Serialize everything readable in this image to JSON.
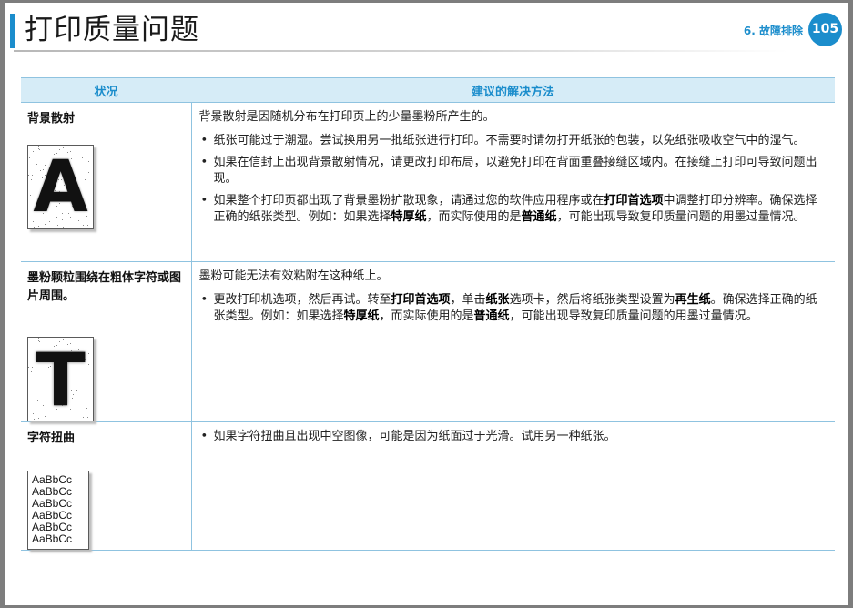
{
  "header": {
    "title": "打印质量问题",
    "chapter": "6. 故障排除",
    "page_number": "105"
  },
  "table": {
    "headers": [
      "状况",
      "建议的解决方法"
    ],
    "rows": [
      {
        "condition": "背景散射",
        "sample_text": "A",
        "intro": "背景散射是因随机分布在打印页上的少量墨粉所产生的。",
        "bullets": [
          [
            {
              "t": "纸张可能过于潮湿。尝试换用另一批纸张进行打印。不需要时请勿打开纸张的包装，以免纸张吸收空气中的湿气。"
            }
          ],
          [
            {
              "t": "如果在信封上出现背景散射情况，请更改打印布局，以避免打印在背面重叠接缝区域内。在接缝上打印可导致问题出现。"
            }
          ],
          [
            {
              "t": "如果整个打印页都出现了背景墨粉扩散现象，请通过您的软件应用程序或在"
            },
            {
              "t": "打印首选项",
              "b": true
            },
            {
              "t": "中调整打印分辨率。确保选择正确的纸张类型。例如：如果选择"
            },
            {
              "t": "特厚纸",
              "b": true
            },
            {
              "t": "，而实际使用的是"
            },
            {
              "t": "普通纸",
              "b": true
            },
            {
              "t": "，可能出现导致复印质量问题的用墨过量情况。"
            }
          ]
        ]
      },
      {
        "condition": "墨粉颗粒围绕在粗体字符或图片周围。",
        "sample_text": "T",
        "intro": "墨粉可能无法有效粘附在这种纸上。",
        "bullets": [
          [
            {
              "t": "更改打印机选项，然后再试。转至"
            },
            {
              "t": "打印首选项",
              "b": true
            },
            {
              "t": "，单击"
            },
            {
              "t": "纸张",
              "b": true
            },
            {
              "t": "选项卡，然后将纸张类型设置为"
            },
            {
              "t": "再生纸",
              "b": true
            },
            {
              "t": "。确保选择正确的纸张类型。例如：如果选择"
            },
            {
              "t": "特厚纸",
              "b": true
            },
            {
              "t": "，而实际使用的是"
            },
            {
              "t": "普通纸",
              "b": true
            },
            {
              "t": "，可能出现导致复印质量问题的用墨过量情况。"
            }
          ]
        ]
      },
      {
        "condition": "字符扭曲",
        "sample_lines": [
          "AaBbCc",
          "AaBbCc",
          "AaBbCc",
          "AaBbCc",
          "AaBbCc",
          "AaBbCc"
        ],
        "intro": "",
        "bullets": [
          [
            {
              "t": "如果字符扭曲且出现中空图像，可能是因为纸面过于光滑。试用另一种纸张。"
            }
          ]
        ]
      }
    ]
  },
  "colors": {
    "accent": "#1b8dcc",
    "header_bg": "#d6ecf7",
    "rule": "#8fc3e0"
  }
}
